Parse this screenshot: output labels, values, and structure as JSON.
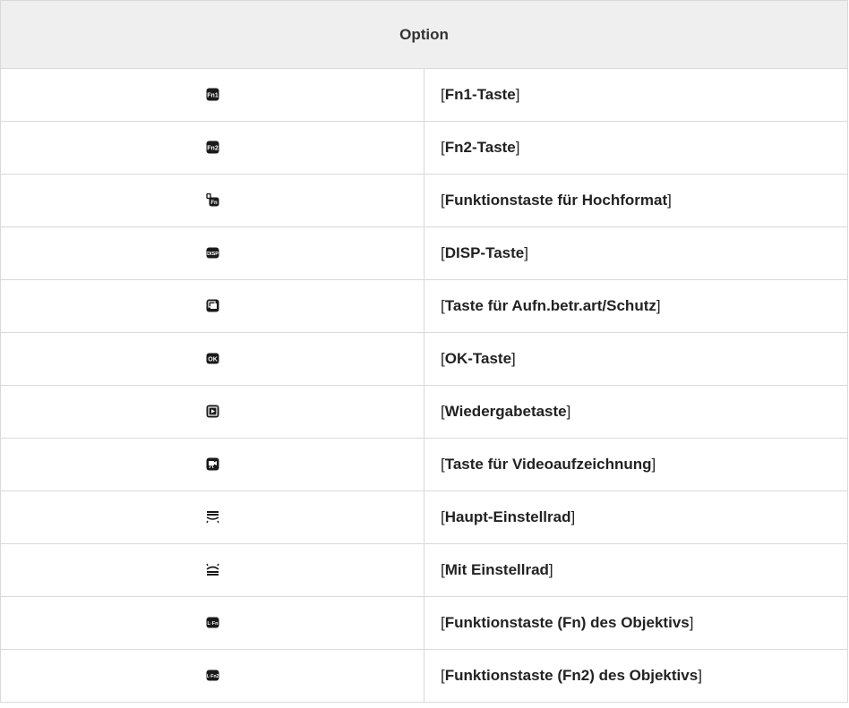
{
  "table": {
    "header": "Option",
    "rows": [
      {
        "icon": "fn1-button-icon",
        "label": "Fn1-Taste"
      },
      {
        "icon": "fn2-button-icon",
        "label": "Fn2-Taste"
      },
      {
        "icon": "vertical-fn-button-icon",
        "label": "Funktionstaste für Hochformat"
      },
      {
        "icon": "disp-button-icon",
        "label": "DISP-Taste"
      },
      {
        "icon": "release-mode-protect-button-icon",
        "label": "Taste für Aufn.betr.art/Schutz"
      },
      {
        "icon": "ok-button-icon",
        "label": "OK-Taste"
      },
      {
        "icon": "playback-button-icon",
        "label": "Wiedergabetaste"
      },
      {
        "icon": "video-record-button-icon",
        "label": "Taste für Videoaufzeichnung"
      },
      {
        "icon": "main-command-dial-icon",
        "label": "Haupt-Einstellrad"
      },
      {
        "icon": "sub-command-dial-icon",
        "label": "Mit Einstellrad"
      },
      {
        "icon": "lens-fn-button-icon",
        "label": "Funktionstaste (Fn) des Objektivs"
      },
      {
        "icon": "lens-fn2-button-icon",
        "label": "Funktionstaste (Fn2) des Objektivs"
      }
    ]
  }
}
